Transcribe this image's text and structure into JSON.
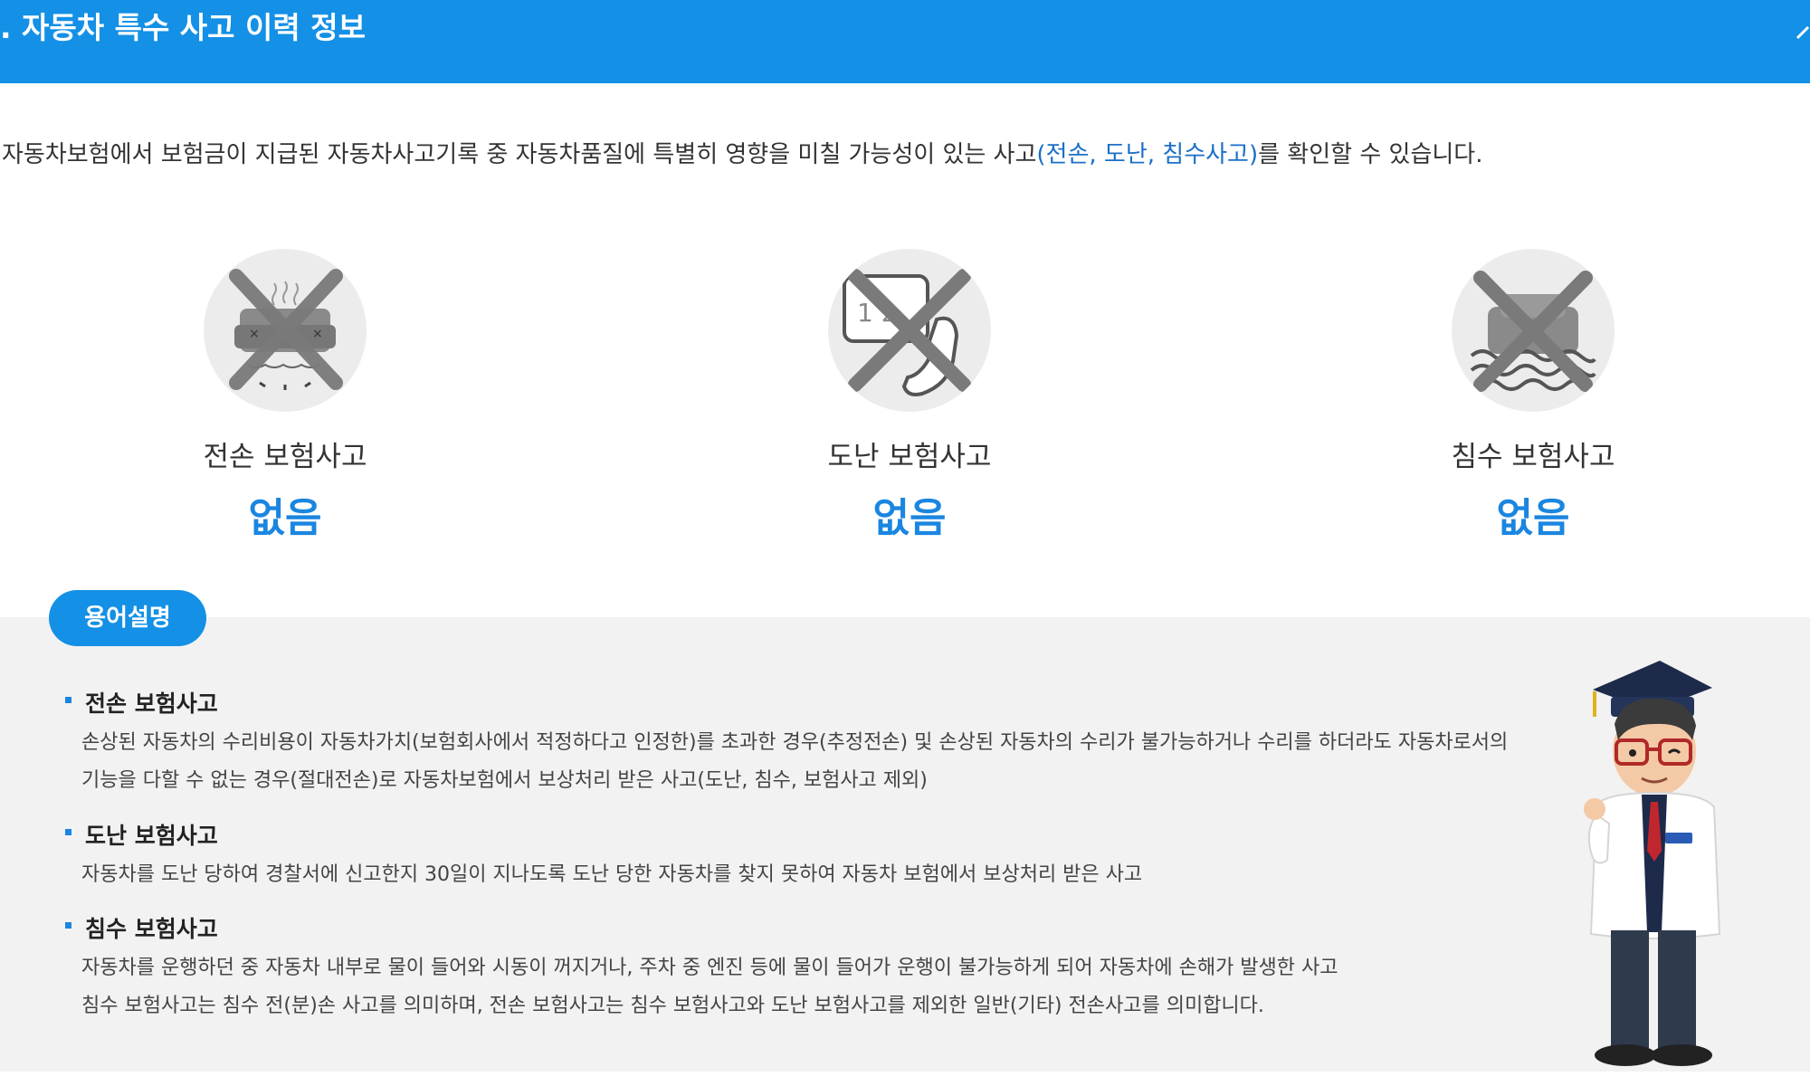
{
  "header": {
    "title": ". 자동차 특수 사고 이력 정보"
  },
  "intro": {
    "before": "자동차보험에서 보험금이 지급된 자동차사고기록 중 자동차품질에 특별히 영향을 미칠 가능성이 있는 사고",
    "highlight": "(전손, 도난, 침수사고)",
    "after": "를 확인할 수 있습니다."
  },
  "cards": [
    {
      "label": "전손 보험사고",
      "value": "없음",
      "icon": "car-wreck-icon"
    },
    {
      "label": "도난 보험사고",
      "value": "없음",
      "icon": "theft-phone-icon"
    },
    {
      "label": "침수 보험사고",
      "value": "없음",
      "icon": "flood-car-icon"
    }
  ],
  "terms": {
    "pill": "용어설명",
    "items": [
      {
        "title": "전손 보험사고",
        "lines": [
          "손상된 자동차의 수리비용이 자동차가치(보험회사에서 적정하다고 인정한)를 초과한 경우(추정전손) 및 손상된 자동차의 수리가 불가능하거나 수리를 하더라도 자동차로서의",
          "기능을 다할 수 없는 경우(절대전손)로 자동차보험에서 보상처리 받은 사고(도난, 침수, 보험사고 제외)"
        ]
      },
      {
        "title": "도난 보험사고",
        "lines": [
          "자동차를 도난 당하여 경찰서에 신고한지 30일이 지나도록 도난 당한 자동차를 찾지 못하여 자동차 보험에서 보상처리 받은 사고"
        ]
      },
      {
        "title": "침수 보험사고",
        "lines": [
          "자동차를 운행하던 중 자동차 내부로 물이 들어와 시동이 꺼지거나, 주차 중 엔진 등에 물이 들어가 운행이 불가능하게 되어 자동차에 손해가 발생한 사고",
          "침수 보험사고는 침수 전(분)손 사고를 의미하며, 전손 보험사고는 침수 보험사고와 도난 보험사고를 제외한 일반(기타) 전손사고를 의미합니다."
        ]
      }
    ]
  },
  "colors": {
    "primary": "#1490e6",
    "value_blue": "#1a86e0",
    "panel_bg": "#f2f2f2"
  }
}
